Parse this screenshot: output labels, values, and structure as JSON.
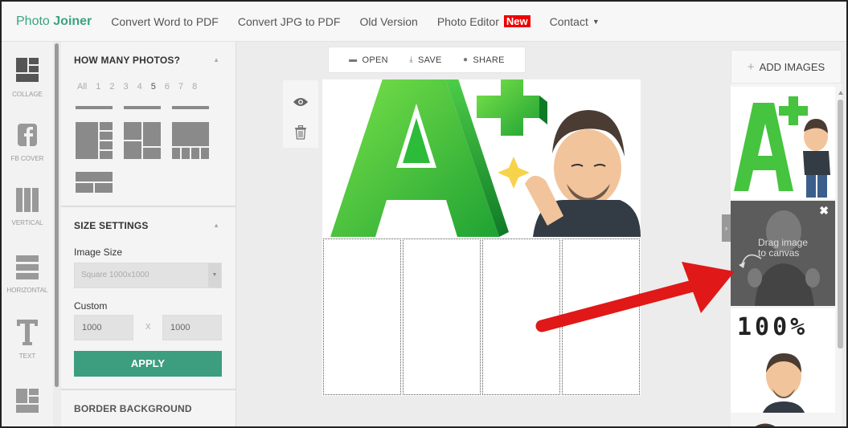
{
  "nav": {
    "logo_part1": "Photo ",
    "logo_part2": "Joiner",
    "links": [
      "Convert Word to PDF",
      "Convert JPG to PDF",
      "Old Version",
      "Photo Editor",
      "Contact"
    ],
    "new_badge": "New"
  },
  "rail": {
    "items": [
      "COLLAGE",
      "FB COVER",
      "VERTICAL",
      "HORIZONTAL",
      "TEXT"
    ]
  },
  "panel": {
    "how_many_title": "HOW MANY PHOTOS?",
    "counts": [
      "All",
      "1",
      "2",
      "3",
      "4",
      "5",
      "6",
      "7",
      "8"
    ],
    "selected_count": "5",
    "size_title": "SIZE SETTINGS",
    "image_size_label": "Image Size",
    "image_size_value": "Square 1000x1000",
    "custom_label": "Custom",
    "width_value": "1000",
    "height_value": "1000",
    "x_sep": "X",
    "apply_label": "APPLY",
    "border_title": "BORDER BACKGROUND"
  },
  "toolbar": {
    "open": "OPEN",
    "save": "SAVE",
    "share": "SHARE"
  },
  "right_panel": {
    "add_images": "ADD IMAGES",
    "drag_hint_line1": "Drag image",
    "drag_hint_line2": "to canvas",
    "thumb3_text": "100%"
  },
  "colors": {
    "brand": "#3aa381",
    "apply": "#3d9d7f",
    "new_badge": "#e00000",
    "arrow": "#e01818"
  }
}
